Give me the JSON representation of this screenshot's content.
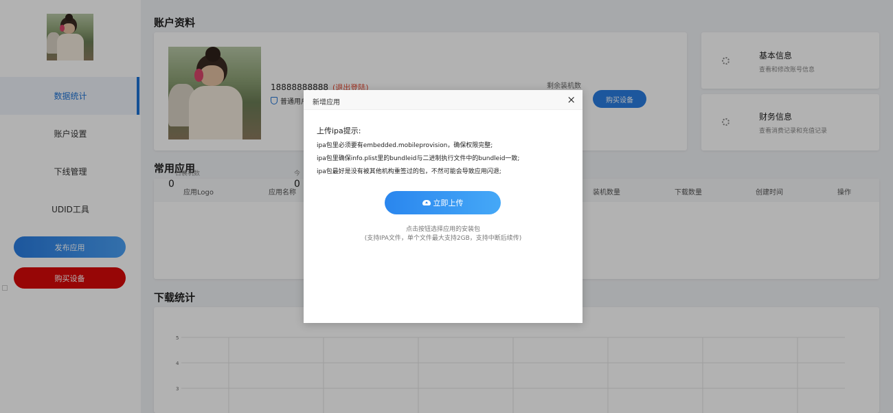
{
  "sidebar": {
    "items": [
      {
        "label": "数据统计"
      },
      {
        "label": "账户设置"
      },
      {
        "label": "下线管理"
      },
      {
        "label": "UDID工具"
      }
    ],
    "publish_label": "发布应用",
    "buy_label": "购买设备"
  },
  "account": {
    "section_title": "账户资料",
    "phone": "18888888888",
    "logout": "(退出登陆)",
    "user_type": "普通用户",
    "remaining_label": "剩余装机数",
    "buy_button": "购买设备"
  },
  "side_cards": [
    {
      "title": "基本信息",
      "subtitle": "查看和修改账号信息"
    },
    {
      "title": "财务信息",
      "subtitle": "查看消费记录和充值记录"
    }
  ],
  "apps": {
    "section_title": "常用应用",
    "stat_1_label": "日装机数",
    "stat_1_value": "0",
    "stat_2_label": "今",
    "stat_2_value": "0",
    "columns": [
      "应用Logo",
      "应用名称",
      "装机数量",
      "下载数量",
      "创建时间",
      "操作"
    ]
  },
  "downloads": {
    "section_title": "下载统计"
  },
  "chart_data": {
    "type": "line",
    "title": "",
    "yticks": [
      "5",
      "4",
      "3"
    ],
    "ylim": [
      3,
      5
    ],
    "grid": true,
    "series": []
  },
  "modal": {
    "title": "新增应用",
    "close": "×",
    "tip_title": "上传ipa提示:",
    "tips": [
      "ipa包里必须要有embedded.mobileprovision，确保权限完整;",
      "ipa包里确保info.plist里的bundleid与二进制执行文件中的bundleid一致;",
      "ipa包最好是没有被其他机构重签过的包，不然可能会导致应用闪退;"
    ],
    "upload_label": "立即上传",
    "hint_line1": "点击按钮选择应用的安装包",
    "hint_line2": "(支持IPA文件，单个文件最大支持2GB，支持中断后续传)"
  }
}
